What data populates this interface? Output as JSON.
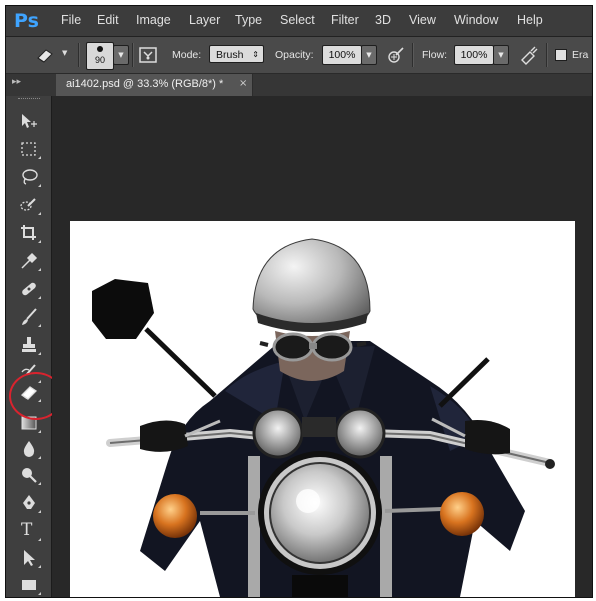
{
  "app": {
    "logo": "Ps"
  },
  "menu": [
    "File",
    "Edit",
    "Image",
    "Layer",
    "Type",
    "Select",
    "Filter",
    "3D",
    "View",
    "Window",
    "Help"
  ],
  "options": {
    "tool_icon": "eraser-icon",
    "brush_size": "90",
    "mode_label": "Mode:",
    "mode_value": "Brush",
    "opacity_label": "Opacity:",
    "opacity_value": "100%",
    "flow_label": "Flow:",
    "flow_value": "100%",
    "erase_history_label": "Era"
  },
  "document_tab": {
    "title": "ai1402.psd @ 33.3% (RGB/8*) *",
    "close": "×"
  },
  "toolbox": {
    "tools": [
      "move-icon",
      "marquee-icon",
      "lasso-icon",
      "quick-select-icon",
      "crop-icon",
      "eyedropper-icon",
      "spot-heal-icon",
      "brush-icon",
      "stamp-icon",
      "history-brush-icon",
      "eraser-icon",
      "gradient-icon",
      "blur-icon",
      "dodge-icon",
      "pen-icon",
      "type-icon",
      "path-select-icon",
      "rectangle-icon"
    ],
    "active_tool": "eraser-icon",
    "type_tool_glyph": "T"
  },
  "colors": {
    "accent": "#3fa4ff",
    "highlight_ring": "#d9232e",
    "canvas_bg": "#ffffff",
    "workspace_bg": "#282828"
  }
}
